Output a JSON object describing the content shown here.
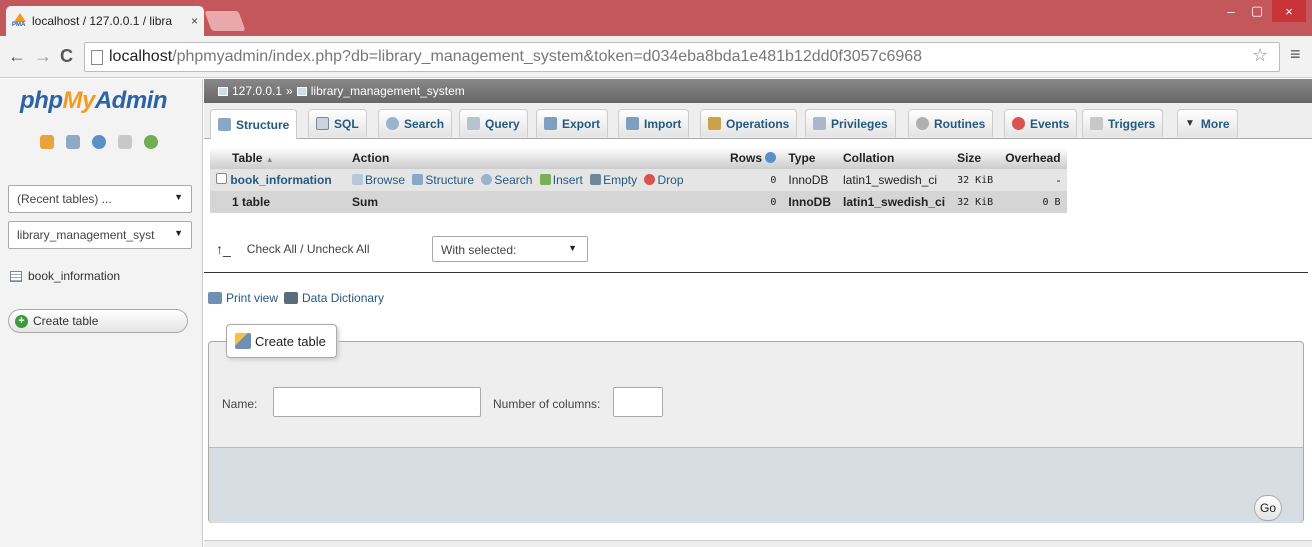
{
  "browser": {
    "tab_title": "localhost / 127.0.0.1 / libra",
    "tab_close": "×",
    "favicon_text": "PMA",
    "url_host": "localhost",
    "url_path": "/phpmyadmin/index.php?db=library_management_system&token=d034eba8bda1e481b12dd0f3057c6968",
    "win_min": "‒",
    "win_max": "▢",
    "win_close": "×"
  },
  "sidebar": {
    "logo_php": "php",
    "logo_my": "My",
    "logo_admin": "Admin",
    "recent_tables": "(Recent tables) ...",
    "database": "library_management_syst",
    "table_link": "book_information",
    "create_table": "Create table"
  },
  "breadcrumb": {
    "server": "127.0.0.1",
    "sep": "»",
    "database": "library_management_system"
  },
  "tabs": [
    {
      "label": "Structure"
    },
    {
      "label": "SQL"
    },
    {
      "label": "Search"
    },
    {
      "label": "Query"
    },
    {
      "label": "Export"
    },
    {
      "label": "Import"
    },
    {
      "label": "Operations"
    },
    {
      "label": "Privileges"
    },
    {
      "label": "Routines"
    },
    {
      "label": "Events"
    },
    {
      "label": "Triggers"
    },
    {
      "label": "More"
    }
  ],
  "table": {
    "headers": {
      "table": "Table",
      "action": "Action",
      "rows": "Rows",
      "type": "Type",
      "collation": "Collation",
      "size": "Size",
      "overhead": "Overhead"
    },
    "sort_indicator": "▲",
    "rows": [
      {
        "name": "book_information",
        "actions": [
          "Browse",
          "Structure",
          "Search",
          "Insert",
          "Empty",
          "Drop"
        ],
        "rows": "0",
        "type": "InnoDB",
        "collation": "latin1_swedish_ci",
        "size": "32 KiB",
        "overhead": "-"
      }
    ],
    "summary": {
      "name": "1 table",
      "action": "Sum",
      "rows": "0",
      "type": "InnoDB",
      "collation": "latin1_swedish_ci",
      "size": "32 KiB",
      "overhead": "0 B"
    }
  },
  "bulk": {
    "check_all": "Check All / Uncheck All",
    "with_selected": "With selected:"
  },
  "links": {
    "print_view": "Print view",
    "data_dictionary": "Data Dictionary"
  },
  "create_form": {
    "legend": "Create table",
    "name_label": "Name:",
    "name_value": "",
    "columns_label": "Number of columns:",
    "columns_value": "",
    "go": "Go"
  }
}
